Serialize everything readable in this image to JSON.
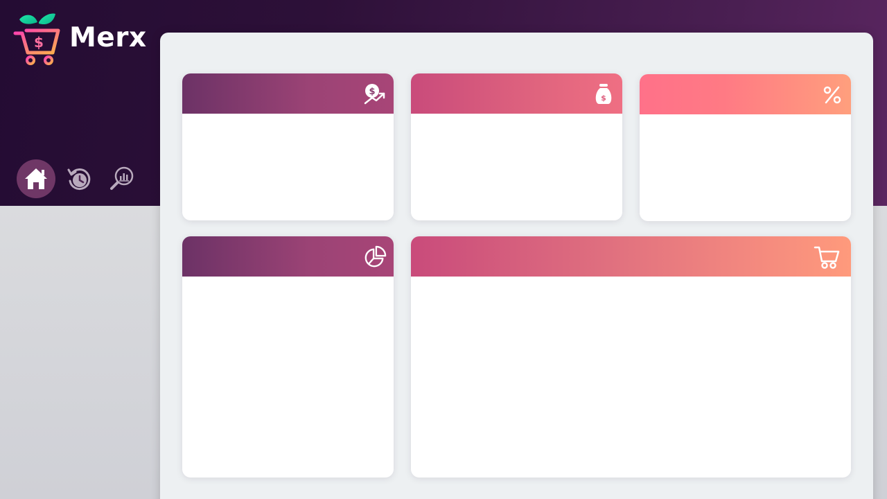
{
  "app": {
    "name": "Merx",
    "logo_icon": "shopping-cart-leaf-logo"
  },
  "nav": {
    "items": [
      {
        "id": "home",
        "icon": "home-icon",
        "active": true
      },
      {
        "id": "history",
        "icon": "history-icon",
        "active": false
      },
      {
        "id": "analytics",
        "icon": "analytics-search-icon",
        "active": false
      }
    ]
  },
  "cards": [
    {
      "id": "revenue",
      "icon": "dollar-growth-icon",
      "title": ""
    },
    {
      "id": "sales",
      "icon": "money-bag-icon",
      "title": ""
    },
    {
      "id": "discounts",
      "icon": "percent-icon",
      "title": ""
    },
    {
      "id": "breakdown",
      "icon": "pie-chart-icon",
      "title": ""
    },
    {
      "id": "orders",
      "icon": "shopping-cart-icon",
      "title": ""
    }
  ],
  "colors": {
    "header_bg_start": "#240c33",
    "header_bg_end": "#5a2660",
    "panel_bg": "#edf0f2",
    "nav_active": "#6f3766",
    "purple_grad": [
      "#6c3266",
      "#a84577"
    ],
    "pink_grad": [
      "#c94b7b",
      "#ef6f83"
    ],
    "coral_grad": [
      "#ff7189",
      "#ff9f7d"
    ]
  }
}
